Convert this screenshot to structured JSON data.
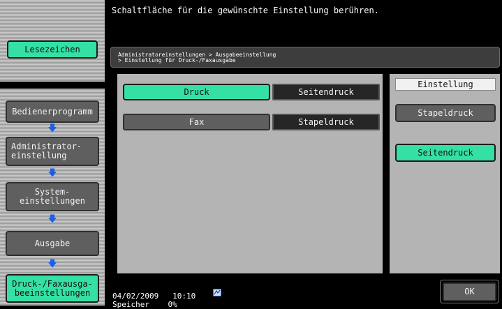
{
  "instruction": "Schaltfläche für die gewünschte Einstellung berühren.",
  "bookmark_label": "Lesezeichen",
  "nav": {
    "bedienerprogramm": "Bedienerprogramm",
    "admin_line1": "Administrator-",
    "admin_line2": "einstellung",
    "system_line1": "System-",
    "system_line2": "einstellungen",
    "ausgabe": "Ausgabe",
    "current_line1": "Druck-/Faxausga-",
    "current_line2": "beeinstellungen",
    "arrow_glyph": "🡇"
  },
  "breadcrumb": {
    "line1": "Administratoreinstellungen > Ausgabeeinstellung",
    "line2": "> Einstellung für Druck-/Faxausgabe"
  },
  "rows": [
    {
      "label": "Druck",
      "value": "Seitendruck",
      "selected": true
    },
    {
      "label": "Fax",
      "value": "Stapeldruck",
      "selected": false
    }
  ],
  "right_panel": {
    "title": "Einstellung",
    "options": [
      {
        "label": "Stapeldruck",
        "selected": false
      },
      {
        "label": "Seitendruck",
        "selected": true
      }
    ]
  },
  "footer": {
    "date": "04/02/2009",
    "time": "10:10",
    "memory_label": "Speicher",
    "memory_value": "0%",
    "ok_label": "OK"
  },
  "colors": {
    "accent_green": "#34e0a4",
    "arrow_blue": "#1a5fe8",
    "panel_gray": "#b4b4b4"
  }
}
